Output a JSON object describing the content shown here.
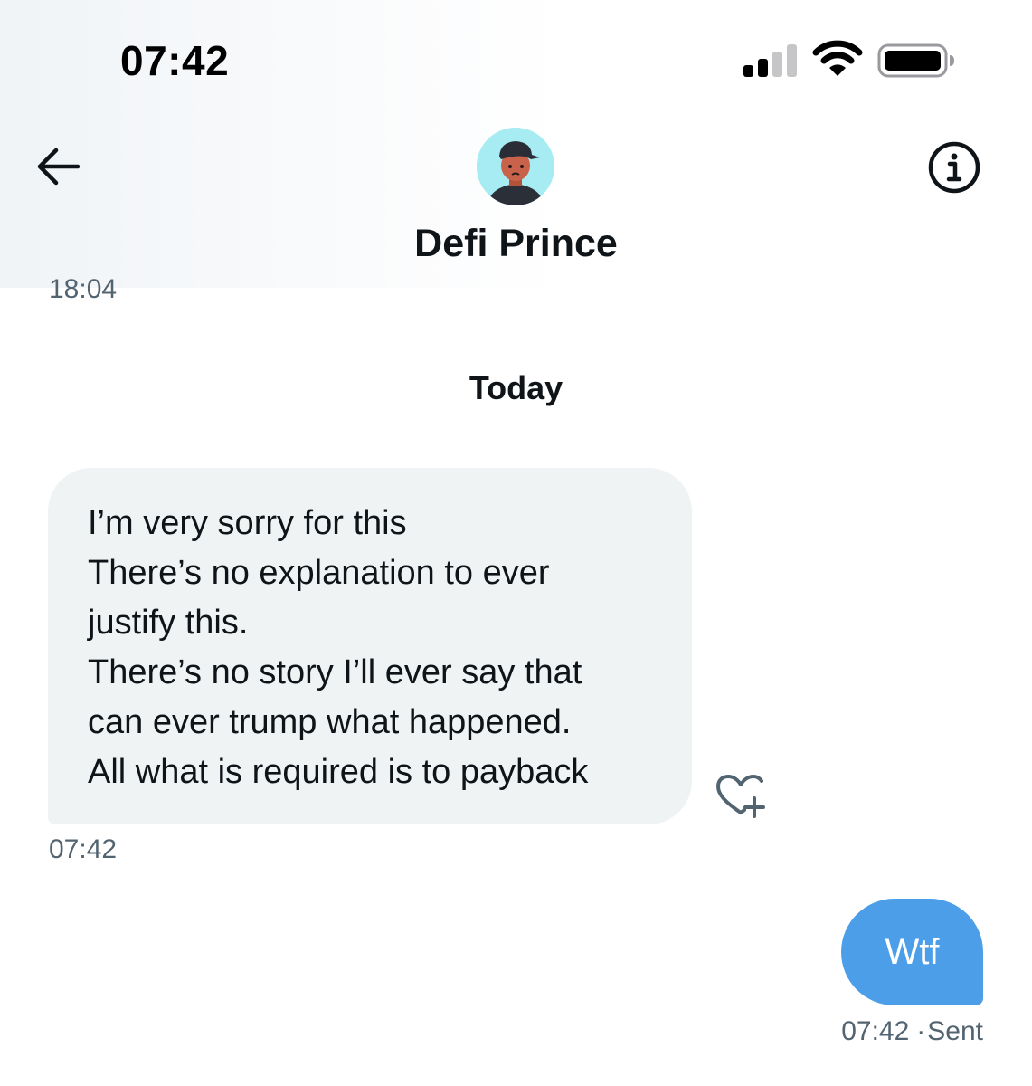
{
  "status_bar": {
    "time": "07:42",
    "icons": [
      "cellular-signal-icon",
      "wifi-icon",
      "battery-icon"
    ]
  },
  "header": {
    "back_icon": "arrow-left-icon",
    "info_icon": "info-circle-icon",
    "contact_name": "Defi Prince",
    "avatar_icon": "cartoon-avatar"
  },
  "conversation": {
    "previous_timestamp": "18:04",
    "day_separator": "Today",
    "messages": [
      {
        "direction": "incoming",
        "lines": [
          "I’m very sorry for this",
          "There’s no explanation to ever",
          "justify this.",
          "There’s no story I’ll ever say that",
          "can ever trump what happened.",
          "All what is required is to payback"
        ],
        "time": "07:42",
        "reaction_icon": "heart-plus-icon"
      },
      {
        "direction": "outgoing",
        "text": "Wtf",
        "time": "07:42",
        "separator": "·",
        "status": "Sent"
      }
    ]
  },
  "colors": {
    "incoming_bubble": "#eff3f4",
    "outgoing_bubble": "#4c9ee9",
    "secondary_text": "#536471",
    "primary_text": "#0f1419"
  }
}
